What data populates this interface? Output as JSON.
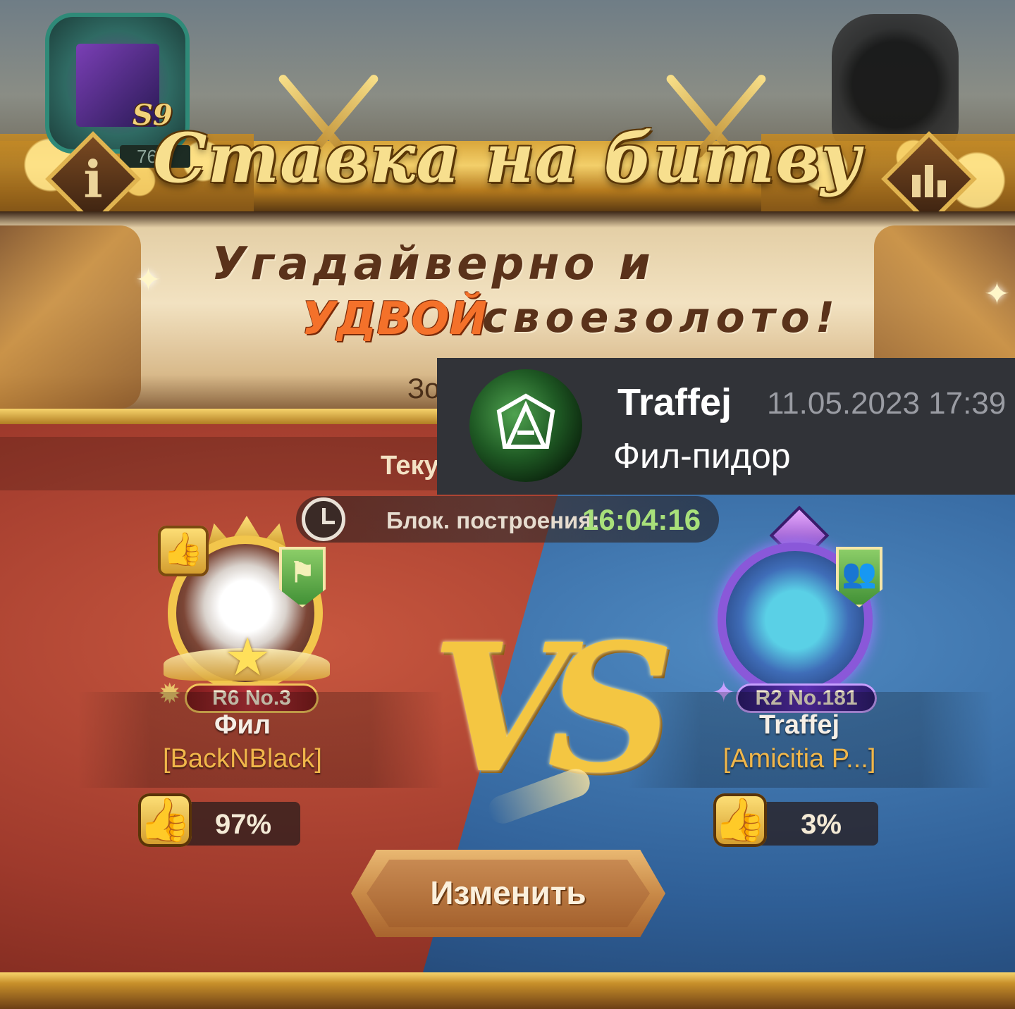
{
  "header": {
    "title": "Ставка на битву",
    "season_label": "S9",
    "season_count": "76",
    "info_icon": "info-icon",
    "stats_icon": "bar-chart-icon"
  },
  "banner": {
    "line1": "Угадайверно и",
    "line2_highlight": "УДВОЙ",
    "line2_rest": "своезолото!",
    "partial_left": "Зо",
    "partial_current": "Теку"
  },
  "timer": {
    "label": "Блок. построения:",
    "value": "16:04:16",
    "value_color": "#a8e07a"
  },
  "players": {
    "left": {
      "rank": "R6 No.3",
      "name": "Фил",
      "guild": "[BackNBlack]",
      "vote_percent": "97%",
      "frame_color": "#f2c64c"
    },
    "right": {
      "rank": "R2 No.181",
      "name": "Traffej",
      "guild": "[Amicitia P...]",
      "vote_percent": "3%",
      "frame_color": "#8a58d9"
    }
  },
  "vs_label": "VS",
  "change_button": "Изменить",
  "chat": {
    "username": "Traffej",
    "timestamp": "11.05.2023 17:39",
    "message": "Фил-пидор",
    "background": "#313338"
  }
}
